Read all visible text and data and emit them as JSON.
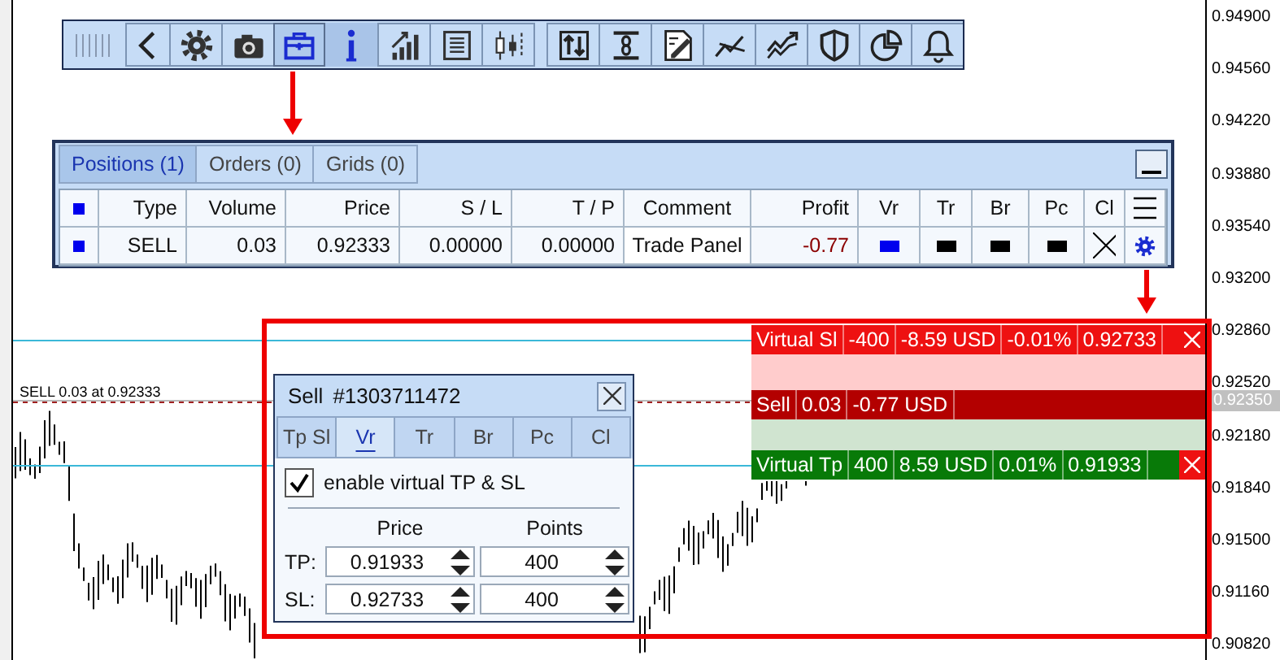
{
  "toolbar": {
    "buttons": [
      {
        "selected": false
      },
      {
        "selected": false
      },
      {
        "selected": false
      },
      {
        "selected": true
      },
      {
        "selected": true
      },
      {
        "selected": false
      },
      {
        "selected": false
      },
      {
        "selected": false
      },
      {
        "selected": false
      },
      {
        "selected": false
      },
      {
        "selected": false
      },
      {
        "selected": false
      },
      {
        "selected": false
      },
      {
        "selected": false
      },
      {
        "selected": false
      },
      {
        "selected": false
      }
    ]
  },
  "positions_panel": {
    "tabs": [
      {
        "label": "Positions (1)",
        "selected": true
      },
      {
        "label": "Orders (0)",
        "selected": false
      },
      {
        "label": "Grids (0)",
        "selected": false
      }
    ],
    "columns": [
      "Type",
      "Volume",
      "Price",
      "S / L",
      "T / P",
      "Comment",
      "Profit",
      "Vr",
      "Tr",
      "Br",
      "Pc",
      "Cl"
    ],
    "rows": [
      {
        "type": "SELL",
        "volume": "0.03",
        "price": "0.92333",
        "sl": "0.00000",
        "tp": "0.00000",
        "comment": "Trade Panel",
        "profit": "-0.77",
        "loss": true,
        "flags": [
          {
            "on": true
          },
          {
            "on": false
          },
          {
            "on": false
          },
          {
            "on": false
          }
        ]
      }
    ]
  },
  "chart": {
    "price_labels": [
      "0.94900",
      "0.94560",
      "0.94220",
      "0.93880",
      "0.93540",
      "0.93200",
      "0.92860",
      "0.92520",
      "0.92180",
      "0.91840",
      "0.91500",
      "0.91160",
      "0.90820"
    ],
    "current_price": "0.92350",
    "order_line_label": "SELL 0.03 at 0.92333"
  },
  "levels": [
    {
      "kind": "stop",
      "cells": [
        "Virtual Sl",
        "-400",
        "-8.59 USD",
        "-0.01%",
        "0.92733"
      ],
      "closable": true
    },
    {
      "kind": "position",
      "cells": [
        "Sell",
        "0.03",
        "-0.77 USD"
      ],
      "closable": false
    },
    {
      "kind": "take",
      "cells": [
        "Virtual Tp",
        "400",
        "8.59 USD",
        "0.01%",
        "0.91933"
      ],
      "closable": true
    }
  ],
  "dialog": {
    "title": "Sell",
    "ticket": "#1303711472",
    "tabs": [
      {
        "label": "Tp Sl",
        "selected": false
      },
      {
        "label": "Vr",
        "selected": true
      },
      {
        "label": "Tr",
        "selected": false
      },
      {
        "label": "Br",
        "selected": false
      },
      {
        "label": "Pc",
        "selected": false
      },
      {
        "label": "Cl",
        "selected": false
      }
    ],
    "checkbox": {
      "label": "enable virtual TP & SL",
      "checked": true
    },
    "headers": [
      "Price",
      "Points"
    ],
    "rows": [
      {
        "label": "TP:",
        "price": "0.91933",
        "points": "400"
      },
      {
        "label": "SL:",
        "price": "0.92733",
        "points": "400"
      }
    ]
  }
}
